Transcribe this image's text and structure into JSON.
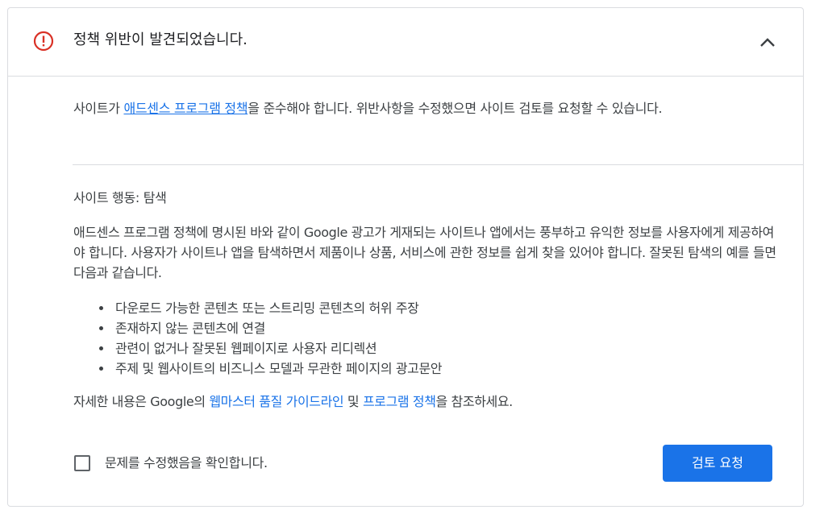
{
  "header": {
    "title": "정책 위반이 발견되었습니다.",
    "alert_icon": "error-circle-icon",
    "alert_color": "#d93025",
    "collapse_icon": "chevron-up-icon"
  },
  "intro": {
    "prefix": "사이트가 ",
    "link": "애드센스 프로그램 정책",
    "suffix": "을 준수해야 합니다. 위반사항을 수정했으면 사이트 검토를 요청할 수 있습니다."
  },
  "section": {
    "title": "사이트 행동: 탐색",
    "body": "애드센스 프로그램 정책에 명시된 바와 같이 Google 광고가 게재되는 사이트나 앱에서는 풍부하고 유익한 정보를 사용자에게 제공하여야 합니다. 사용자가 사이트나 앱을 탐색하면서 제품이나 상품, 서비스에 관한 정보를 쉽게 찾을 있어야 합니다. 잘못된 탐색의 예를 들면 다음과 같습니다.",
    "bullets": [
      "다운로드 가능한 콘텐츠 또는 스트리밍 콘텐츠의 허위 주장",
      "존재하지 않는 콘텐츠에 연결",
      "관련이 없거나 잘못된 웹페이지로 사용자 리디렉션",
      "주제 및 웹사이트의 비즈니스 모델과 무관한 페이지의 광고문안"
    ]
  },
  "more_info": {
    "prefix": "자세한 내용은 Google의 ",
    "link1": "웹마스터 품질 가이드라인",
    "middle": " 및 ",
    "link2": "프로그램 정책",
    "suffix": "을 참조하세요."
  },
  "footer": {
    "confirm_label": "문제를 수정했음을 확인합니다.",
    "confirm_checked": false,
    "review_button": "검토 요청",
    "accent": "#1a73e8"
  }
}
